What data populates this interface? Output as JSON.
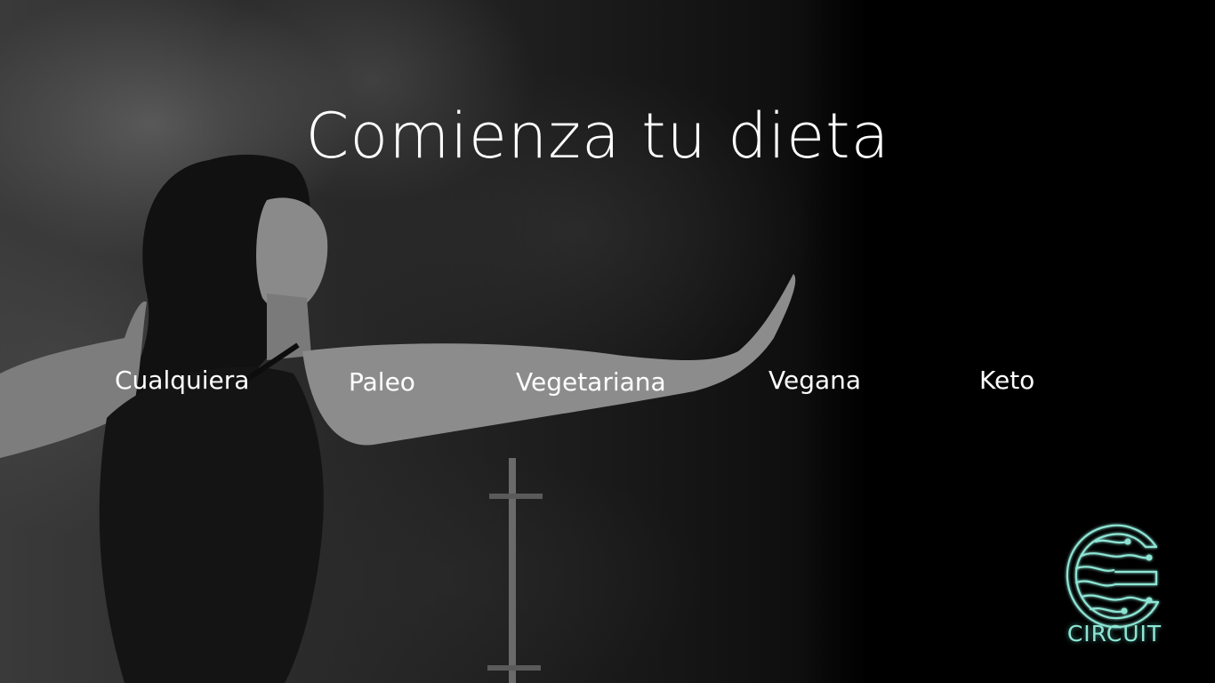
{
  "hero": {
    "title": "Comienza tu dieta"
  },
  "diet_options": [
    {
      "label": "Cualquiera"
    },
    {
      "label": "Paleo"
    },
    {
      "label": "Vegetariana"
    },
    {
      "label": "Vegana"
    },
    {
      "label": "Keto"
    }
  ],
  "brand": {
    "name": "CIRCUIT",
    "icon": "circuit-logo-icon",
    "color": "#8ee6d5"
  },
  "background": {
    "icon": "woman-stretching-photo",
    "color": "#000000"
  }
}
